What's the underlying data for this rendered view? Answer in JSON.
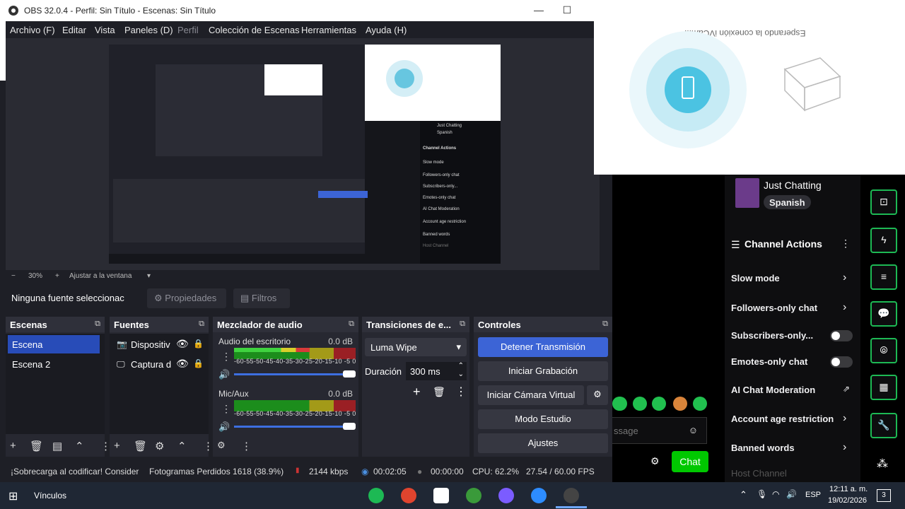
{
  "window": {
    "title": "OBS 32.0.4 - Perfil: Sin Título - Escenas: Sin Título",
    "minimize": "—",
    "maximize": "☐"
  },
  "menu": [
    "Archivo (F)",
    "Editar",
    "Vista",
    "Paneles (D)",
    "Perfil",
    "Colección de Escenas",
    "Herramientas",
    "Ayuda (H)"
  ],
  "zoom": {
    "minus": "−",
    "value": "30%",
    "plus": "+",
    "fit": "Ajustar a la ventana"
  },
  "source_bar": {
    "none_selected": "Ninguna fuente seleccionac",
    "properties": "Propiedades",
    "filters": "Filtros"
  },
  "scenes": {
    "title": "Escenas",
    "items": [
      "Escena",
      "Escena 2"
    ]
  },
  "sources": {
    "title": "Fuentes",
    "items": [
      {
        "label": "Dispositiv",
        "icon": "camera-icon"
      },
      {
        "label": "Captura d",
        "icon": "monitor-icon"
      }
    ]
  },
  "mixer": {
    "title": "Mezclador de audio",
    "channels": [
      {
        "name": "Audio del escritorio",
        "db": "0.0 dB",
        "level": 0.62
      },
      {
        "name": "Mic/Aux",
        "db": "0.0 dB",
        "level": 0.0
      }
    ],
    "scale": "-60-55-50-45-40-35-30-25-20-15-10 -5 0"
  },
  "transitions": {
    "title": "Transiciones de e...",
    "selected": "Luma Wipe",
    "duration_label": "Duración",
    "duration_value": "300 ms"
  },
  "controls": {
    "title": "Controles",
    "stop_stream": "Detener Transmisión",
    "start_recording": "Iniciar Grabación",
    "virtual_camera": "Iniciar Cámara Virtual",
    "studio_mode": "Modo Estudio",
    "settings": "Ajustes"
  },
  "status": {
    "overload": "¡Sobrecarga al codificar! Consider",
    "dropped_frames": "Fotogramas Perdidos 1618 (38.9%)",
    "bitrate": "2144 kbps",
    "stream_time": "00:02:05",
    "rec_time": "00:00:00",
    "cpu": "CPU: 62.2%",
    "fps": "27.54 / 60.00 FPS"
  },
  "ivcam": {
    "message": "Esperando la conexión iVCam..."
  },
  "twitch": {
    "category": "Just Chatting",
    "tag": "Spanish",
    "channel_actions": "Channel Actions",
    "rows": [
      {
        "label": "Slow mode",
        "type": "chevron"
      },
      {
        "label": "Followers-only chat",
        "type": "chevron"
      },
      {
        "label": "Subscribers-only...",
        "type": "toggle"
      },
      {
        "label": "Emotes-only chat",
        "type": "toggle"
      },
      {
        "label": "AI Chat Moderation",
        "type": "external"
      },
      {
        "label": "Account age restriction",
        "type": "chevron"
      },
      {
        "label": "Banned words",
        "type": "chevron"
      }
    ],
    "host_channel": "Host Channel",
    "message_placeholder": "ssage",
    "chat_button": "Chat"
  },
  "taskbar": {
    "links": "Vínculos",
    "lang": "ESP",
    "time": "12:11 a. m.",
    "date": "19/02/2026",
    "notifications": "3"
  },
  "colors": {
    "accent": "#3c64d6",
    "twitch_green": "#1db954",
    "chat_button": "#00c800"
  }
}
